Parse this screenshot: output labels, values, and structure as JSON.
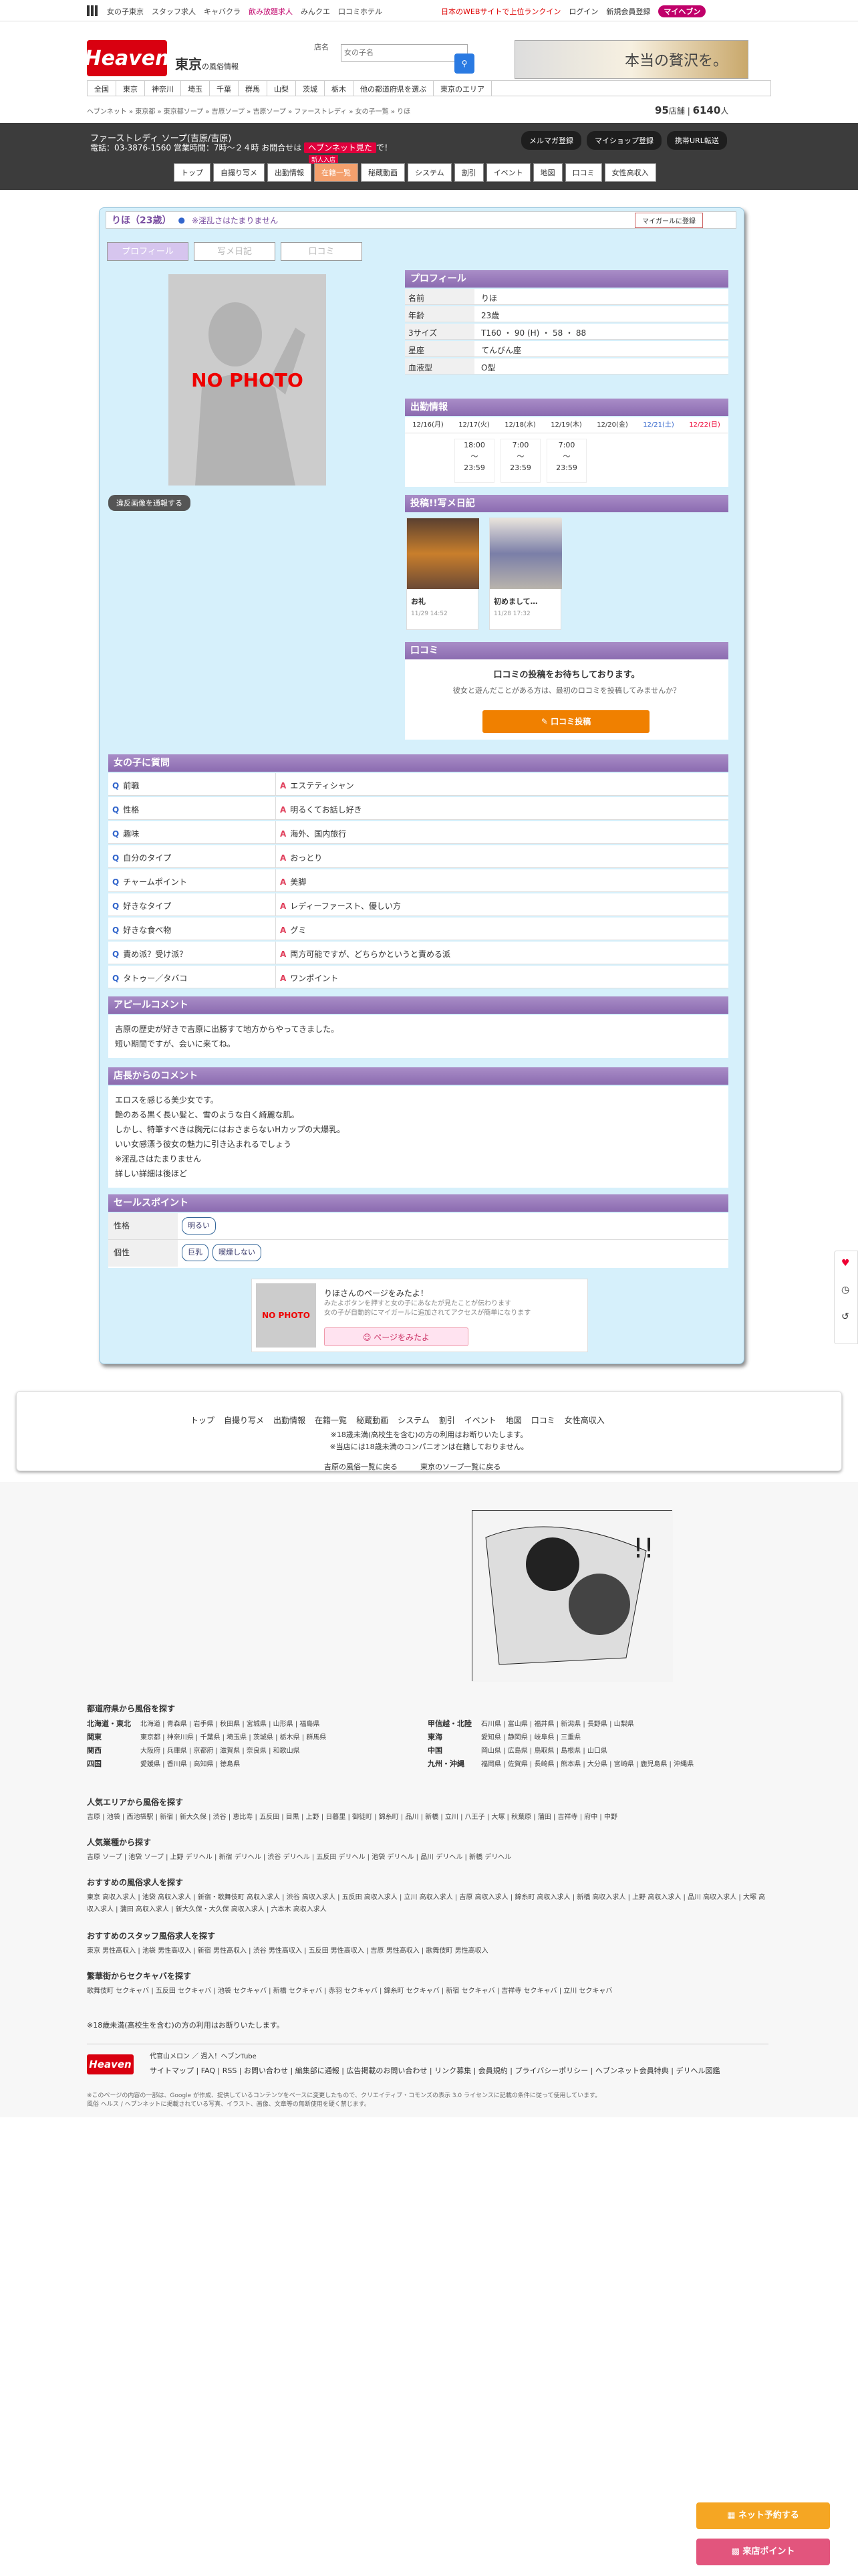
{
  "top": {
    "links": [
      "女の子東京",
      "スタッフ求人",
      "キャバクラ",
      "飲み放題求人",
      "みんクエ",
      "口コミホテル"
    ],
    "right": [
      "日本のWEBサイトで上位ランクイン",
      "ログイン",
      "新規会員登録",
      "マイヘブン"
    ]
  },
  "header": {
    "logo": "Heaven",
    "region": "東京",
    "region_sub": "の風俗情報",
    "search_label": "店名",
    "search_placeholder": "女の子名",
    "ad": "本当の贅沢を。"
  },
  "nav": [
    "全国",
    "東京",
    "神奈川",
    "埼玉",
    "千葉",
    "群馬",
    "山梨",
    "茨城",
    "栃木",
    "他の都道府県を選ぶ",
    "東京のエリア"
  ],
  "breadcrumb": "ヘブンネット » 東京都 » 東京都ソープ » 吉原ソープ » 吉原ソープ » ファーストレディ » 女の子一覧 » りほ",
  "stats": {
    "count1": "95",
    "unit1": "店舗",
    "count2": "6140",
    "unit2": "人"
  },
  "shop": {
    "name": "ファーストレディ ソープ(吉原/吉原)",
    "tel": "電話：03-3876-1560 営業時間：7時〜２４時 お問合せは",
    "now": "ヘブンネット見た",
    "now_suffix": "で！",
    "buttons": [
      "メルマガ登録",
      "マイショップ登録",
      "携帯URL転送"
    ],
    "tabs": [
      "トップ",
      "自撮り写メ",
      "出勤情報",
      "在籍一覧",
      "秘蔵動画",
      "システム",
      "割引",
      "イベント",
      "地図",
      "口コミ",
      "女性高収入"
    ],
    "new_badge": "新人入店"
  },
  "girl": {
    "name": "りほ（23歳）",
    "message": "※淫乱さはたまりません",
    "mygirl": "マイガールに登録",
    "tabs": [
      "プロフィール",
      "写メ日記",
      "口コミ"
    ],
    "nophoto": "NO PHOTO",
    "report": "違反画像を通報する"
  },
  "profile": {
    "title": "プロフィール",
    "rows": [
      {
        "k": "名前",
        "v": "りほ"
      },
      {
        "k": "年齢",
        "v": "23歳"
      },
      {
        "k": "3サイズ",
        "v": "T160 ・ 90 (H) ・ 58 ・ 88"
      },
      {
        "k": "星座",
        "v": "てんびん座"
      },
      {
        "k": "血液型",
        "v": "O型"
      }
    ]
  },
  "schedule": {
    "title": "出勤情報",
    "days": [
      "12/16(月)",
      "12/17(火)",
      "12/18(水)",
      "12/19(木)",
      "12/20(金)",
      "12/21(土)",
      "12/22(日)"
    ],
    "slots": [
      {
        "start": "18:00",
        "end": "23:59"
      },
      {
        "start": "7:00",
        "end": "23:59"
      },
      {
        "start": "7:00",
        "end": "23:59"
      }
    ],
    "sep": "〜"
  },
  "diary": {
    "title": "投稿!!写メ日記",
    "items": [
      {
        "title": "お礼",
        "date": "11/29 14:52"
      },
      {
        "title": "初めまして…",
        "date": "11/28 17:32"
      }
    ]
  },
  "kuchikomi": {
    "title": "口コミ",
    "line1": "口コミの投稿をお待ちしております。",
    "line2": "彼女と遊んだことがある方は、最初のロコミを投稿してみませんか？",
    "button": "口コミ投稿"
  },
  "qa": {
    "title": "女の子に質問",
    "items": [
      {
        "q": "前職",
        "a": "エステティシャン"
      },
      {
        "q": "性格",
        "a": "明るくてお話し好き"
      },
      {
        "q": "趣味",
        "a": "海外、国内旅行"
      },
      {
        "q": "自分のタイプ",
        "a": "おっとり"
      },
      {
        "q": "チャームポイント",
        "a": "美脚"
      },
      {
        "q": "好きなタイプ",
        "a": "レディーファースト、優しい方"
      },
      {
        "q": "好きな食べ物",
        "a": "グミ"
      },
      {
        "q": "責め派？受け派？",
        "a": "両方可能ですが、どちらかというと責める派"
      },
      {
        "q": "タトゥー／タバコ",
        "a": "ワンポイント"
      }
    ]
  },
  "appeal": {
    "title": "アピールコメント",
    "lines": [
      "吉原の歴史が好きで吉原に出勝すて地方からやってきました。",
      "短い期間ですが、会いに来てね。"
    ]
  },
  "shopcomment": {
    "title": "店長からのコメント",
    "lines": [
      "エロスを感じる美少女です。",
      "艶のある黒く長い髪と、雪のような白く綺麗な肌。",
      "しかし、特筆すべきは胸元にはおさまらないHカップの大爆乳。",
      "いい女感漂う彼女の魅力に引き込まれるでしょう",
      "※淫乱さはたまりません",
      "詳しい詳細は後ほど"
    ]
  },
  "sales": {
    "title": "セールスポイント",
    "rows": [
      {
        "k": "性格",
        "tags": [
          "明るい"
        ]
      },
      {
        "k": "個性",
        "tags": [
          "巨乳",
          "喫煙しない"
        ]
      }
    ]
  },
  "visit": {
    "t1": "りほさんのページをみたよ！",
    "t2a": "みたよボタンを押すと女の子にあなたが見たことが伝わります",
    "t2b": "女の子が自動的にマイガールに追加されてアクセスが簡単になります",
    "btn": "ページをみたよ"
  },
  "footer_nav": {
    "links": [
      "トップ",
      "自撮り写メ",
      "出勤情報",
      "在籍一覧",
      "秘蔵動画",
      "システム",
      "割引",
      "イベント",
      "地図",
      "口コミ",
      "女性高収入"
    ],
    "n1": "※18歳未満(高校生を含む)の方の利用はお断りいたします。",
    "n2": "※当店には18歳未満のコンパニオンは在籍しておりません。",
    "back1": "吉原の風俗一覧に戻る",
    "back2": "東京のソープ一覧に戻る"
  },
  "pref": {
    "title": "都道府県から風俗を探す",
    "rows": [
      {
        "n": "北海道・東北",
        "v": "北海道 | 青森県 | 岩手県 | 秋田県 | 宮城県 | 山形県 | 福島県",
        "n2": "甲信越・北陸",
        "v2": "石川県 | 富山県 | 福井県 | 新潟県 | 長野県 | 山梨県"
      },
      {
        "n": "関東",
        "v": "東京都 | 神奈川県 | 千葉県 | 埼玉県 | 茨城県 | 栃木県 | 群馬県",
        "n2": "東海",
        "v2": "愛知県 | 静岡県 | 岐阜県 | 三重県"
      },
      {
        "n": "関西",
        "v": "大阪府 | 兵庫県 | 京都府 | 滋賀県 | 奈良県 | 和歌山県",
        "n2": "中国",
        "v2": "岡山県 | 広島県 | 鳥取県 | 島根県 | 山口県"
      },
      {
        "n": "四国",
        "v": "愛媛県 | 香川県 | 高知県 | 徳島県",
        "n2": "九州・沖縄",
        "v2": "福岡県 | 佐賀県 | 長崎県 | 熊本県 | 大分県 | 宮崎県 | 鹿児島県 | 沖縄県"
      }
    ]
  },
  "popular_area": {
    "title": "人気エリアから風俗を探す",
    "text": "吉原 | 池袋 | 西池袋駅 | 新宿 | 新大久保 | 渋谷 | 恵比寿 | 五反田 | 目黒 | 上野 | 日暮里 | 御徒町 | 錦糸町 | 品川 | 新橋 | 立川 | 八王子 | 大塚 | 秋葉原 | 蒲田 | 吉祥寺 | 府中 | 中野"
  },
  "popular_type": {
    "title": "人気業種から探す",
    "text": "吉原 ソープ | 池袋 ソープ | 上野 デリヘル | 新宿 デリヘル | 渋谷 デリヘル | 五反田 デリヘル | 池袋 デリヘル | 品川 デリヘル | 新橋 デリヘル"
  },
  "recruit": {
    "title": "おすすめの風俗求人を探す",
    "text": "東京 高収入求人 | 池袋 高収入求人 | 新宿・歌舞伎町 高収入求人 | 渋谷 高収入求人 | 五反田 高収入求人 | 立川 高収入求人 | 吉原 高収入求人 | 錦糸町 高収入求人 | 新橋 高収入求人 | 上野 高収入求人 | 品川 高収入求人 | 大塚 高収入求人 | 蒲田 高収入求人 | 新大久保・大久保 高収入求人 | 六本木 高収入求人"
  },
  "staff": {
    "title": "おすすめのスタッフ風俗求人を探す",
    "text": "東京 男性高収入 | 池袋 男性高収入 | 新宿 男性高収入 | 渋谷 男性高収入 | 五反田 男性高収入 | 吉原 男性高収入 | 歌舞伎町 男性高収入"
  },
  "cabaret": {
    "title": "繁華街からセクキャバを探す",
    "text": "歌舞伎町 セクキャバ | 五反田 セクキャバ | 池袋 セクキャバ | 新橋 セクキャバ | 赤羽 セクキャバ | 錦糸町 セクキャバ | 新宿 セクキャバ | 吉祥寺 セクキャバ | 立川 セクキャバ"
  },
  "footnote": "※18歳未満(高校生を含む)の方の利用はお断りいたします。",
  "footer": {
    "logo": "Heaven",
    "sub": "代官山メロン ／ 週入！ヘブンTube",
    "links": "サイトマップ | FAQ | RSS | お問い合わせ | 編集部に通報 | 広告掲載のお問い合わせ | リンク募集 | 会員規約 | プライバシーポリシー | ヘブンネット会員特典 | デリヘル図鑑",
    "copy1": "※このページの内容の一部は、Google が作成、提供しているコンテンツをベースに変更したもので、クリエイティブ・コモンズの表示 3.0 ライセンスに記載の条件に従って使用しています。",
    "copy2": "風俗 ヘルス / ヘブンネットに掲載されている写真、イラスト、画像、文章等の無断使用を硬く禁じます。"
  },
  "floating": {
    "b1": "ネット予約する",
    "b2": "来店ポイント"
  }
}
